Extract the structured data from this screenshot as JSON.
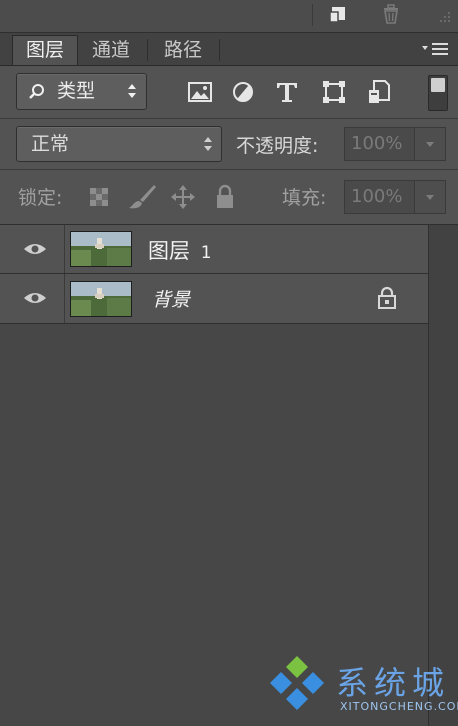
{
  "tabs": [
    {
      "label": "图层",
      "active": true
    },
    {
      "label": "通道",
      "active": false
    },
    {
      "label": "路径",
      "active": false
    }
  ],
  "filter": {
    "kind_label": "类型",
    "filter_icons": [
      "image-filter-icon",
      "adjustment-filter-icon",
      "type-filter-icon",
      "shape-filter-icon",
      "smart-object-filter-icon"
    ]
  },
  "blend": {
    "mode": "正常",
    "opacity_label": "不透明度:",
    "opacity_value": "100%"
  },
  "lock": {
    "label": "锁定:",
    "fill_label": "填充:",
    "fill_value": "100%"
  },
  "layers": [
    {
      "name": "图层",
      "number": "1",
      "visible": true,
      "locked": false
    },
    {
      "name": "背景",
      "visible": true,
      "locked": true
    }
  ],
  "watermark": {
    "text": "系统城",
    "sub": "XITONGCHENG.COM"
  },
  "colors": {
    "panel": "#535353",
    "list_bg": "#474747",
    "watermark_blue": "#3b8fe0",
    "watermark_green": "#7cc242"
  }
}
